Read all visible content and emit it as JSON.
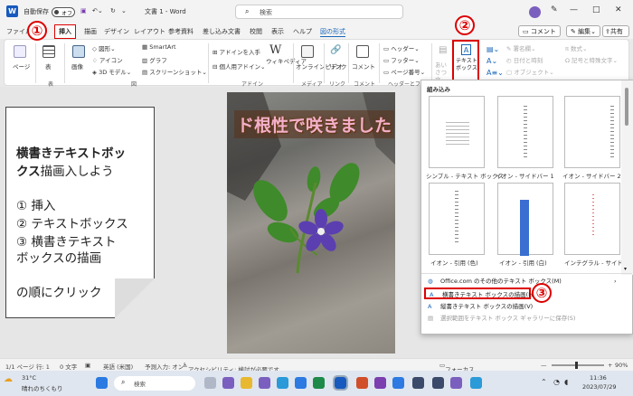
{
  "titlebar": {
    "logo": "W",
    "autosave": "自動保存",
    "autosave_state": "オフ",
    "doc_title": "文書 1 - Word",
    "search_placeholder": "検索"
  },
  "tabs": [
    "ファイル",
    "挿入",
    "描画",
    "デザイン",
    "レイアウト",
    "参考資料",
    "差し込み文書",
    "校閲",
    "表示",
    "ヘルプ",
    "図の形式"
  ],
  "tab_buttons": {
    "comment": "コメント",
    "edit": "編集",
    "share": "共有"
  },
  "ribbon": {
    "page": "ページ",
    "table": "表",
    "image": "画像",
    "shapes": "図形",
    "icons": "アイコン",
    "model3d": "3D モデル",
    "smartart": "SmartArt",
    "graph": "グラフ",
    "screenshot": "スクリーンショット",
    "addin": "アドインを入手",
    "personal_addin": "個人用アドイン",
    "wiki": "ウィキペディア",
    "online_video": "オンラインビデオ",
    "link": "リンク",
    "comment": "コメント",
    "header": "ヘッダー",
    "footer": "フッター",
    "page_number": "ページ番号",
    "aisatsu": "あいさつ文",
    "textbox": "テキストボックス",
    "signature": "署名欄",
    "datetime": "日付と時刻",
    "object": "オブジェクト",
    "equation": "数式",
    "symbol": "記号と特殊文字",
    "groups": {
      "table": "表",
      "illust": "図",
      "addin": "アドイン",
      "media": "メディア",
      "link": "リンク",
      "comment": "コメント",
      "hf": "ヘッダーとフッター"
    }
  },
  "note": {
    "line1": "横書きテキストボッ",
    "line2_bold": "クス",
    "line2_rest": "描画入しよう",
    "step1": "① 挿入",
    "step2": "② テキストボックス",
    "step3a": "③ 横書きテキスト",
    "step3b": "ボックスの描画",
    "footer": "の順にクリック"
  },
  "document": {
    "title": "ド根性で咲きました"
  },
  "dropdown": {
    "section": "組み込み",
    "thumbs": [
      "シンプル - テキスト ボックス",
      "イオン - サイドバー 1",
      "イオン - サイドバー 2",
      "イオン - 引用 (色)",
      "イオン - 引用 (白)",
      "インテグラル - サイドバー"
    ],
    "items": [
      {
        "label": "Office.com のその他のテキスト ボックス(M)",
        "state": "normal"
      },
      {
        "label": "横書きテキスト ボックスの描画(H)",
        "state": "highlight"
      },
      {
        "label": "縦書きテキスト ボックスの描画(V)",
        "state": "normal"
      },
      {
        "label": "選択範囲をテキスト ボックス ギャラリーに保存(S)",
        "state": "disabled"
      }
    ]
  },
  "badges": [
    "①",
    "②",
    "③"
  ],
  "status": {
    "page": "1/1 ページ",
    "line": "行: 1",
    "col": "0 文字",
    "lang": "英語 (米国)",
    "predict": "予測入力: オン",
    "access": "アクセシビリティ: 検討が必要です",
    "focus": "フォーカス",
    "zoom": "90%"
  },
  "taskbar": {
    "temp": "31°C",
    "weather": "晴れのちくもり",
    "search": "検索",
    "time": "11:36",
    "date": "2023/07/29"
  },
  "colors": {
    "accent": "#185abd",
    "highlight": "#dd0000"
  }
}
